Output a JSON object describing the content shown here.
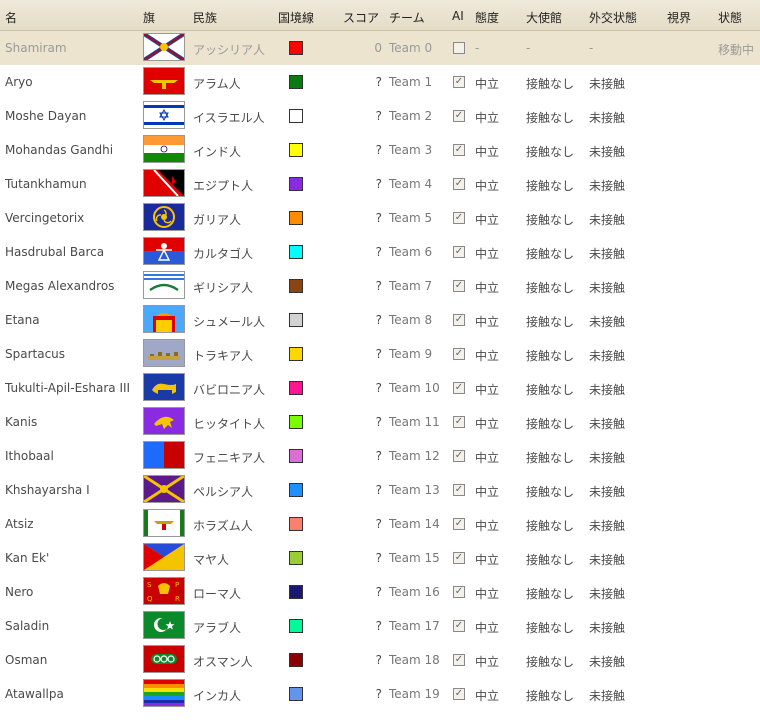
{
  "header": {
    "name": "名",
    "flag": "旗",
    "nation": "民族",
    "border_color": "国境線",
    "score": "スコア",
    "team": "チーム",
    "ai": "AI",
    "stance": "態度",
    "embassy": "大使館",
    "diplomatic": "外交状態",
    "vision": "視界",
    "state": "状態"
  },
  "players": [
    {
      "name": "Shamiram",
      "flag_icon": "assyria-flag-icon",
      "nation": "アッシリア人",
      "color": "#ff0000",
      "score": "0",
      "team": "Team 0",
      "ai_checked": false,
      "stance": "-",
      "embassy": "-",
      "diplomatic": "-",
      "state": "移動中",
      "selected": true
    },
    {
      "name": "Aryo",
      "flag_icon": "aramean-flag-icon",
      "nation": "アラム人",
      "color": "#0a7a12",
      "score": "?",
      "team": "Team 1",
      "ai_checked": true,
      "stance": "中立",
      "embassy": "接触なし",
      "diplomatic": "未接触",
      "state": "",
      "selected": false
    },
    {
      "name": "Moshe Dayan",
      "flag_icon": "israel-flag-icon",
      "nation": "イスラエル人",
      "color": "#ffffff",
      "score": "?",
      "team": "Team 2",
      "ai_checked": true,
      "stance": "中立",
      "embassy": "接触なし",
      "diplomatic": "未接触",
      "state": "",
      "selected": false
    },
    {
      "name": "Mohandas Gandhi",
      "flag_icon": "india-flag-icon",
      "nation": "インド人",
      "color": "#ffff00",
      "score": "?",
      "team": "Team 3",
      "ai_checked": true,
      "stance": "中立",
      "embassy": "接触なし",
      "diplomatic": "未接触",
      "state": "",
      "selected": false
    },
    {
      "name": "Tutankhamun",
      "flag_icon": "egypt-flag-icon",
      "nation": "エジプト人",
      "color": "#8a2be2",
      "score": "?",
      "team": "Team 4",
      "ai_checked": true,
      "stance": "中立",
      "embassy": "接触なし",
      "diplomatic": "未接触",
      "state": "",
      "selected": false
    },
    {
      "name": "Vercingetorix",
      "flag_icon": "gaul-flag-icon",
      "nation": "ガリア人",
      "color": "#ff8c00",
      "score": "?",
      "team": "Team 5",
      "ai_checked": true,
      "stance": "中立",
      "embassy": "接触なし",
      "diplomatic": "未接触",
      "state": "",
      "selected": false
    },
    {
      "name": "Hasdrubal Barca",
      "flag_icon": "carthage-flag-icon",
      "nation": "カルタゴ人",
      "color": "#00ffff",
      "score": "?",
      "team": "Team 6",
      "ai_checked": true,
      "stance": "中立",
      "embassy": "接触なし",
      "diplomatic": "未接触",
      "state": "",
      "selected": false
    },
    {
      "name": "Megas Alexandros",
      "flag_icon": "greece-flag-icon",
      "nation": "ギリシア人",
      "color": "#8b4513",
      "score": "?",
      "team": "Team 7",
      "ai_checked": true,
      "stance": "中立",
      "embassy": "接触なし",
      "diplomatic": "未接触",
      "state": "",
      "selected": false
    },
    {
      "name": "Etana",
      "flag_icon": "sumer-flag-icon",
      "nation": "シュメール人",
      "color": "#d3d3d3",
      "score": "?",
      "team": "Team 8",
      "ai_checked": true,
      "stance": "中立",
      "embassy": "接触なし",
      "diplomatic": "未接触",
      "state": "",
      "selected": false
    },
    {
      "name": "Spartacus",
      "flag_icon": "thrace-flag-icon",
      "nation": "トラキア人",
      "color": "#ffd700",
      "score": "?",
      "team": "Team 9",
      "ai_checked": true,
      "stance": "中立",
      "embassy": "接触なし",
      "diplomatic": "未接触",
      "state": "",
      "selected": false
    },
    {
      "name": "Tukulti-Apil-Eshara III",
      "flag_icon": "babylon-flag-icon",
      "nation": "バビロニア人",
      "color": "#ff1493",
      "score": "?",
      "team": "Team 10",
      "ai_checked": true,
      "stance": "中立",
      "embassy": "接触なし",
      "diplomatic": "未接触",
      "state": "",
      "selected": false
    },
    {
      "name": "Kanis",
      "flag_icon": "hittite-flag-icon",
      "nation": "ヒッタイト人",
      "color": "#7cfc00",
      "score": "?",
      "team": "Team 11",
      "ai_checked": true,
      "stance": "中立",
      "embassy": "接触なし",
      "diplomatic": "未接触",
      "state": "",
      "selected": false
    },
    {
      "name": "Ithobaal",
      "flag_icon": "phoenicia-flag-icon",
      "nation": "フェニキア人",
      "color": "#da70d6",
      "score": "?",
      "team": "Team 12",
      "ai_checked": true,
      "stance": "中立",
      "embassy": "接触なし",
      "diplomatic": "未接触",
      "state": "",
      "selected": false
    },
    {
      "name": "Khshayarsha I",
      "flag_icon": "persia-flag-icon",
      "nation": "ペルシア人",
      "color": "#1e90ff",
      "score": "?",
      "team": "Team 13",
      "ai_checked": true,
      "stance": "中立",
      "embassy": "接触なし",
      "diplomatic": "未接触",
      "state": "",
      "selected": false
    },
    {
      "name": "Atsiz",
      "flag_icon": "khwarezm-flag-icon",
      "nation": "ホラズム人",
      "color": "#fa8072",
      "score": "?",
      "team": "Team 14",
      "ai_checked": true,
      "stance": "中立",
      "embassy": "接触なし",
      "diplomatic": "未接触",
      "state": "",
      "selected": false
    },
    {
      "name": "Kan Ek'",
      "flag_icon": "maya-flag-icon",
      "nation": "マヤ人",
      "color": "#9acd32",
      "score": "?",
      "team": "Team 15",
      "ai_checked": true,
      "stance": "中立",
      "embassy": "接触なし",
      "diplomatic": "未接触",
      "state": "",
      "selected": false
    },
    {
      "name": "Nero",
      "flag_icon": "rome-flag-icon",
      "nation": "ローマ人",
      "color": "#191970",
      "score": "?",
      "team": "Team 16",
      "ai_checked": true,
      "stance": "中立",
      "embassy": "接触なし",
      "diplomatic": "未接触",
      "state": "",
      "selected": false
    },
    {
      "name": "Saladin",
      "flag_icon": "arab-flag-icon",
      "nation": "アラブ人",
      "color": "#00fa9a",
      "score": "?",
      "team": "Team 17",
      "ai_checked": true,
      "stance": "中立",
      "embassy": "接触なし",
      "diplomatic": "未接触",
      "state": "",
      "selected": false
    },
    {
      "name": "Osman",
      "flag_icon": "ottoman-flag-icon",
      "nation": "オスマン人",
      "color": "#8b0000",
      "score": "?",
      "team": "Team 18",
      "ai_checked": true,
      "stance": "中立",
      "embassy": "接触なし",
      "diplomatic": "未接触",
      "state": "",
      "selected": false
    },
    {
      "name": "Atawallpa",
      "flag_icon": "inca-flag-icon",
      "nation": "インカ人",
      "color": "#6495ed",
      "score": "?",
      "team": "Team 19",
      "ai_checked": true,
      "stance": "中立",
      "embassy": "接触なし",
      "diplomatic": "未接触",
      "state": "",
      "selected": false
    }
  ]
}
